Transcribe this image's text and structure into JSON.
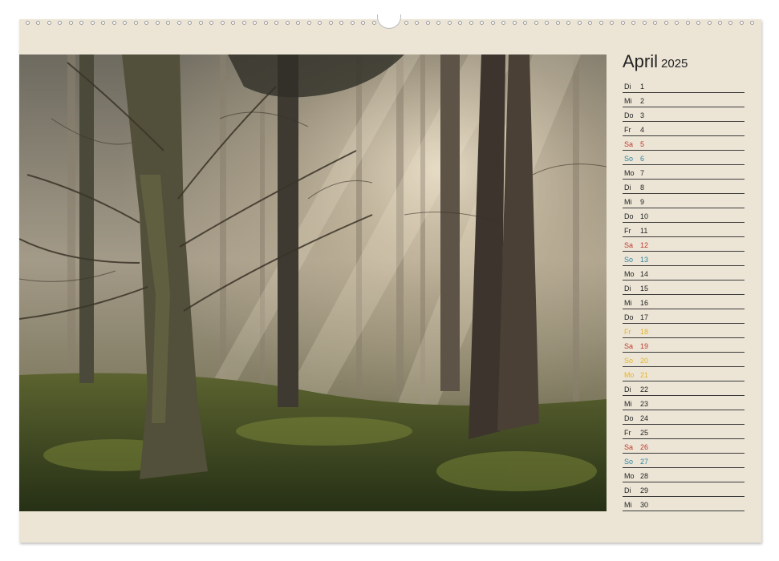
{
  "calendar": {
    "month": "April",
    "year": "2025",
    "days": [
      {
        "wd": "Di",
        "d": "1",
        "t": ""
      },
      {
        "wd": "Mi",
        "d": "2",
        "t": ""
      },
      {
        "wd": "Do",
        "d": "3",
        "t": ""
      },
      {
        "wd": "Fr",
        "d": "4",
        "t": ""
      },
      {
        "wd": "Sa",
        "d": "5",
        "t": "sa"
      },
      {
        "wd": "So",
        "d": "6",
        "t": "so"
      },
      {
        "wd": "Mo",
        "d": "7",
        "t": ""
      },
      {
        "wd": "Di",
        "d": "8",
        "t": ""
      },
      {
        "wd": "Mi",
        "d": "9",
        "t": ""
      },
      {
        "wd": "Do",
        "d": "10",
        "t": ""
      },
      {
        "wd": "Fr",
        "d": "11",
        "t": ""
      },
      {
        "wd": "Sa",
        "d": "12",
        "t": "sa"
      },
      {
        "wd": "So",
        "d": "13",
        "t": "so"
      },
      {
        "wd": "Mo",
        "d": "14",
        "t": ""
      },
      {
        "wd": "Di",
        "d": "15",
        "t": ""
      },
      {
        "wd": "Mi",
        "d": "16",
        "t": ""
      },
      {
        "wd": "Do",
        "d": "17",
        "t": ""
      },
      {
        "wd": "Fr",
        "d": "18",
        "t": "hol"
      },
      {
        "wd": "Sa",
        "d": "19",
        "t": "sa"
      },
      {
        "wd": "So",
        "d": "20",
        "t": "hol"
      },
      {
        "wd": "Mo",
        "d": "21",
        "t": "hol"
      },
      {
        "wd": "Di",
        "d": "22",
        "t": ""
      },
      {
        "wd": "Mi",
        "d": "23",
        "t": ""
      },
      {
        "wd": "Do",
        "d": "24",
        "t": ""
      },
      {
        "wd": "Fr",
        "d": "25",
        "t": ""
      },
      {
        "wd": "Sa",
        "d": "26",
        "t": "sa"
      },
      {
        "wd": "So",
        "d": "27",
        "t": "so"
      },
      {
        "wd": "Mo",
        "d": "28",
        "t": ""
      },
      {
        "wd": "Di",
        "d": "29",
        "t": ""
      },
      {
        "wd": "Mi",
        "d": "30",
        "t": ""
      }
    ]
  },
  "colors": {
    "paper": "#ece5d6",
    "saturday": "#c0392b",
    "sunday": "#2e86a3",
    "holiday": "#e5b422"
  },
  "photo": {
    "subject": "misty-forest-sunbeams"
  }
}
